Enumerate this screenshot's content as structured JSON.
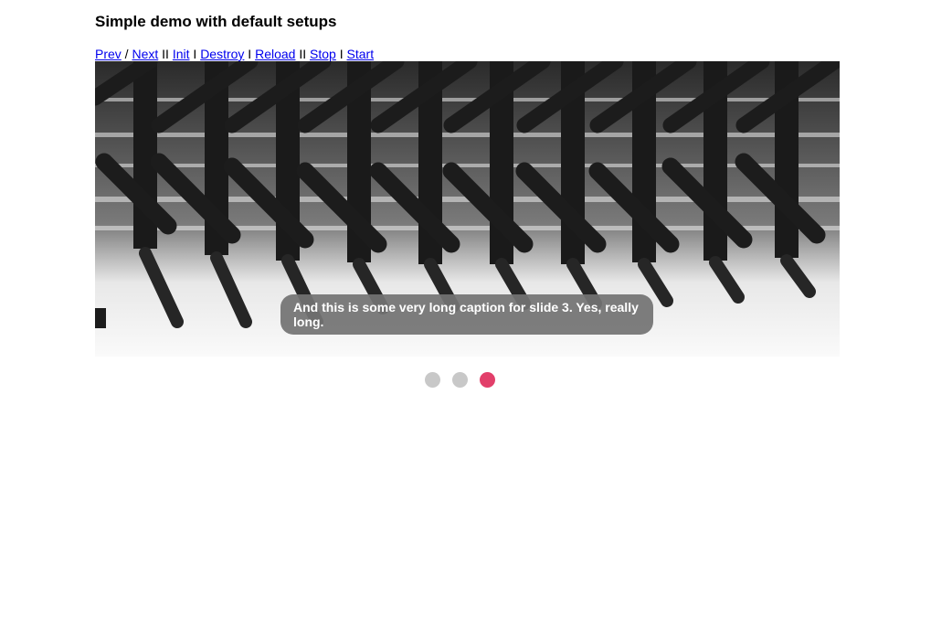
{
  "page": {
    "title": "Simple demo with default setups"
  },
  "controls": {
    "prev": "Prev",
    "sep_slash": " / ",
    "next": "Next",
    "sep_double1": " II ",
    "init": "Init",
    "sep1": " I ",
    "destroy": "Destroy",
    "sep2": " I ",
    "reload": "Reload",
    "sep_double2": " II ",
    "stop": "Stop",
    "sep3": " I ",
    "start": "Start"
  },
  "slider": {
    "caption": "And this is some very long caption for slide 3. Yes, really long.",
    "current_slide": 3,
    "total_slides": 3
  },
  "colors": {
    "active_dot": "#e23f6a",
    "inactive_dot": "#c8c8c8",
    "link": "#0000ee",
    "caption_bg": "#737373"
  }
}
